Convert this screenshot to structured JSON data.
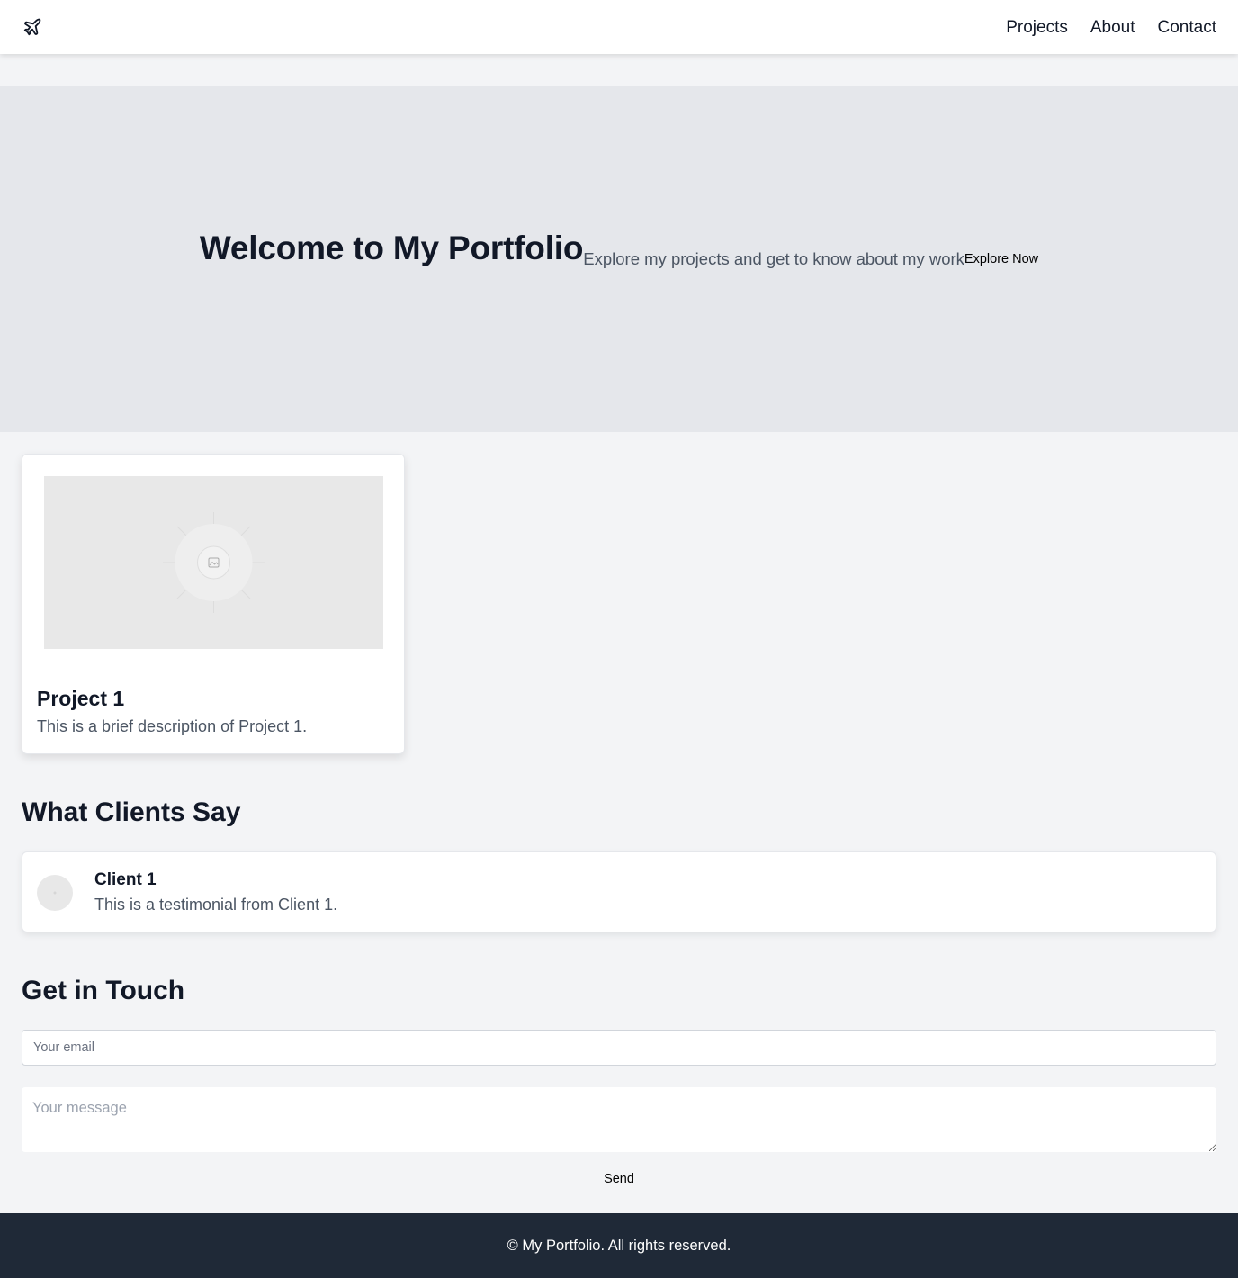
{
  "header": {
    "logo_icon": "airplane-icon",
    "nav": [
      {
        "label": "Projects"
      },
      {
        "label": "About"
      },
      {
        "label": "Contact"
      }
    ]
  },
  "hero": {
    "title": "Welcome to My Portfolio",
    "subtitle": "Explore my projects and get to know about my work",
    "button_label": "Explore Now",
    "background_color": "#e5e7eb"
  },
  "projects": [
    {
      "title": "Project 1",
      "description": "This is a brief description of Project 1.",
      "image_icon": "image-placeholder-icon"
    }
  ],
  "testimonials": {
    "heading": "What Clients Say",
    "items": [
      {
        "name": "Client 1",
        "text": "This is a testimonial from Client 1.",
        "avatar_icon": "avatar-placeholder-icon"
      }
    ]
  },
  "contact": {
    "heading": "Get in Touch",
    "email_placeholder": "Your email",
    "message_placeholder": "Your message",
    "send_label": "Send"
  },
  "footer": {
    "text": "© My Portfolio. All rights reserved.",
    "background_color": "#1f2937"
  },
  "colors": {
    "page_background": "#f3f4f6",
    "text_primary": "#111827",
    "text_secondary": "#4b5563"
  }
}
